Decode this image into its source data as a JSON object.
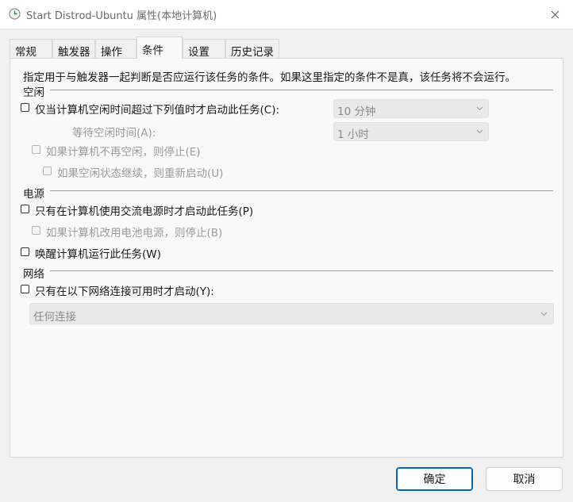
{
  "window": {
    "title": "Start Distrod-Ubuntu 属性(本地计算机)",
    "icon": "task-scheduler-clock-icon"
  },
  "tabs": [
    {
      "label": "常规",
      "active": false
    },
    {
      "label": "触发器",
      "active": false
    },
    {
      "label": "操作",
      "active": false
    },
    {
      "label": "条件",
      "active": true
    },
    {
      "label": "设置",
      "active": false
    },
    {
      "label": "历史记录",
      "active": false
    }
  ],
  "description": "指定用于与触发器一起判断是否应运行该任务的条件。如果这里指定的条件不是真，该任务将不会运行。",
  "idle": {
    "section_label": "空闲",
    "start_if_idle": {
      "label": "仅当计算机空闲时间超过下列值时才启动此任务(C):",
      "checked": false
    },
    "idle_duration": {
      "value": "10 分钟"
    },
    "wait_label": "等待空闲时间(A):",
    "wait_duration": {
      "value": "1 小时"
    },
    "stop_if_not_idle": {
      "label": "如果计算机不再空闲，则停止(E)",
      "checked": false
    },
    "restart_if_idle": {
      "label": "如果空闲状态继续，则重新启动(U)",
      "checked": false
    }
  },
  "power": {
    "section_label": "电源",
    "ac_only": {
      "label": "只有在计算机使用交流电源时才启动此任务(P)",
      "checked": false
    },
    "stop_on_battery": {
      "label": "如果计算机改用电池电源，则停止(B)",
      "checked": false
    },
    "wake_to_run": {
      "label": "唤醒计算机运行此任务(W)",
      "checked": false
    }
  },
  "network": {
    "section_label": "网络",
    "network_only": {
      "label": "只有在以下网络连接可用时才启动(Y):",
      "checked": false
    },
    "connection": {
      "value": "任何连接"
    }
  },
  "buttons": {
    "ok": "确定",
    "cancel": "取消"
  },
  "colors": {
    "accent": "#0067c0",
    "disabled_text": "#9b9b9b",
    "panel_bg": "#f9f9f9",
    "window_bg": "#f0f0f0"
  }
}
